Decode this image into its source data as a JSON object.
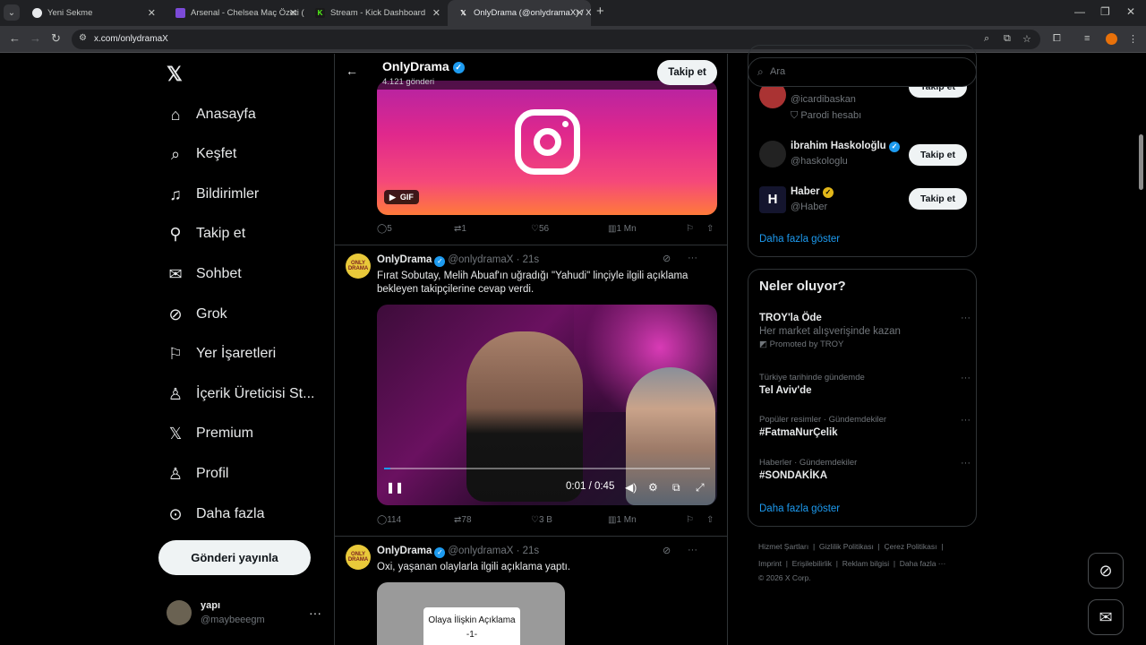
{
  "browser": {
    "tabs": [
      {
        "title": "Yeni Sekme",
        "active": false
      },
      {
        "title": "Arsenal - Chelsea Maç Özeti (V...",
        "active": false
      },
      {
        "title": "Stream - Kick Dashboard",
        "active": false
      },
      {
        "title": "OnlyDrama (@onlydramaX) / X",
        "active": true
      }
    ],
    "url": "x.com/onlydramaX"
  },
  "sidebar": {
    "items": [
      {
        "label": "Anasayfa",
        "icon": "home-icon"
      },
      {
        "label": "Keşfet",
        "icon": "search-icon"
      },
      {
        "label": "Bildirimler",
        "icon": "bell-icon"
      },
      {
        "label": "Takip et",
        "icon": "follow-icon"
      },
      {
        "label": "Sohbet",
        "icon": "mail-icon"
      },
      {
        "label": "Grok",
        "icon": "grok-icon"
      },
      {
        "label": "Yer İşaretleri",
        "icon": "bookmark-icon"
      },
      {
        "label": "İçerik Üreticisi St...",
        "icon": "creator-icon"
      },
      {
        "label": "Premium",
        "icon": "x-logo-icon"
      },
      {
        "label": "Profil",
        "icon": "person-icon"
      },
      {
        "label": "Daha fazla",
        "icon": "more-circle-icon"
      }
    ],
    "post_button": "Gönderi yayınla",
    "account": {
      "name": "yapı",
      "handle": "@maybeeegm"
    }
  },
  "profile_header": {
    "name": "OnlyDrama",
    "post_count": "4.121 gönderi",
    "follow_label": "Takip et"
  },
  "tweets": [
    {
      "media_badge": "GIF",
      "stats": {
        "replies": "5",
        "reposts": "1",
        "likes": "56",
        "views": "1 Mn"
      }
    },
    {
      "name": "OnlyDrama",
      "handle": "@onlydramaX",
      "time": "21s",
      "text": "Fırat Sobutay, Melih Abuaf'ın uğradığı \"Yahudi\" linçiyle ilgili açıklama bekleyen takipçilerine cevap verdi.",
      "video_time": "0:01 / 0:45",
      "video_progress": 0.02,
      "stats": {
        "replies": "114",
        "reposts": "78",
        "likes": "3 B",
        "views": "1 Mn"
      }
    },
    {
      "name": "OnlyDrama",
      "handle": "@onlydramaX",
      "time": "21s",
      "text": "Oxi, yaşanan olaylarla ilgili açıklama yaptı.",
      "media_card": "Olaya İlişkin Açıklama",
      "media_card_sub": "-1-"
    }
  ],
  "right": {
    "search_placeholder": "Ara",
    "who_to_follow": [
      {
        "name": "",
        "handle": "@icardibaskan",
        "extra": "Parodi hesabı",
        "button": "Takip et"
      },
      {
        "name": "ibrahim Haskoloğlu",
        "handle": "@haskologlu",
        "button": "Takip et"
      },
      {
        "name": "Haber",
        "handle": "@Haber",
        "button": "Takip et"
      }
    ],
    "show_more": "Daha fazla göster",
    "trends_title": "Neler oluyor?",
    "trends": [
      {
        "meta": "",
        "title": "TROY'la Öde",
        "sub": "Her market alışverişinde kazan",
        "promo": "Promoted by TROY"
      },
      {
        "meta": "Türkiye tarihinde gündemde",
        "title": "Tel Aviv'de"
      },
      {
        "meta": "Popüler resimler · Gündemdekiler",
        "title": "#FatmaNurÇelik"
      },
      {
        "meta": "Haberler · Gündemdekiler",
        "title": "#SONDAKİKA"
      }
    ],
    "trends_more": "Daha fazla göster",
    "footer": {
      "line1": [
        "Hizmet Şartları",
        "Gizlilik Politikası",
        "Çerez Politikası"
      ],
      "line2": [
        "Imprint",
        "Erişilebilirlik",
        "Reklam bilgisi",
        "Daha fazla ···"
      ],
      "copyright": "© 2026 X Corp."
    }
  },
  "colors": {
    "accent": "#1d9bf0",
    "background": "#000000",
    "border": "#2f3336"
  }
}
